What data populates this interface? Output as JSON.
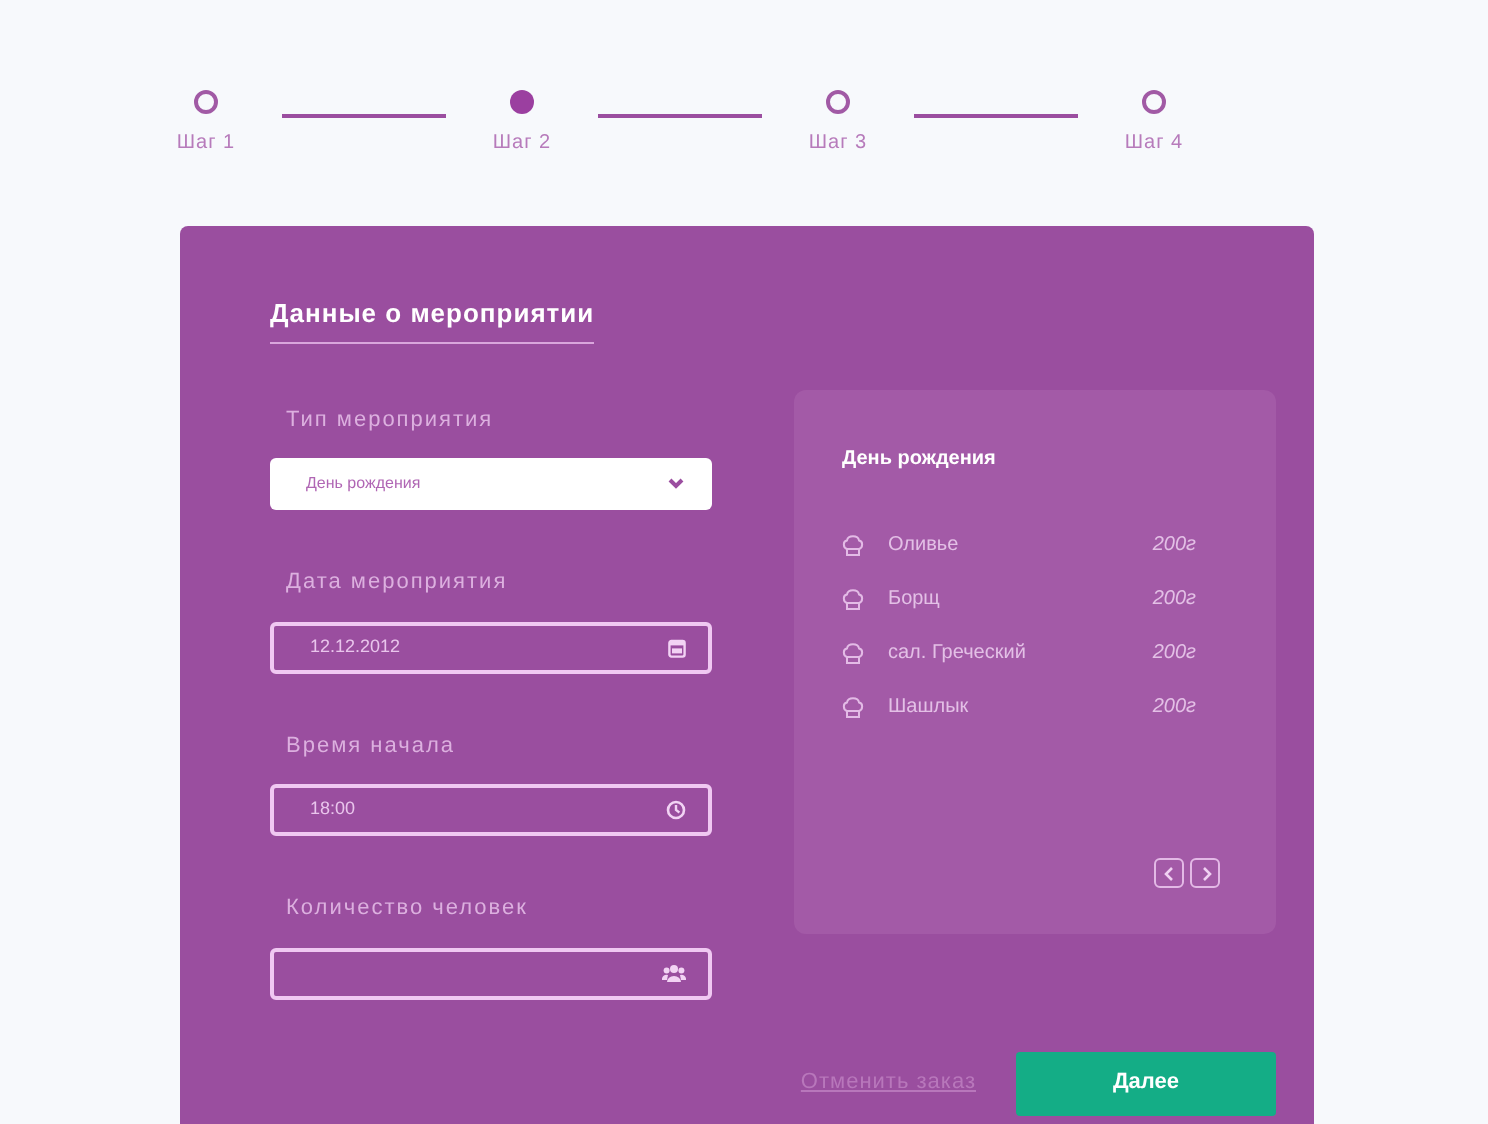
{
  "steps": [
    {
      "label": "Шаг 1",
      "selected": false
    },
    {
      "label": "Шаг 2",
      "selected": true
    },
    {
      "label": "Шаг 3",
      "selected": false
    },
    {
      "label": "Шаг 4",
      "selected": false
    }
  ],
  "form": {
    "title": "Данные о мероприятии",
    "fields": [
      {
        "kind": "select",
        "label": "Тип мероприятия",
        "value": "День рождения"
      },
      {
        "kind": "date",
        "label": "Дата мероприятия",
        "value": "12.12.2012"
      },
      {
        "kind": "time",
        "label": "Время начала",
        "value": "18:00"
      },
      {
        "kind": "people",
        "label": "Количество человек"
      }
    ]
  },
  "menu": {
    "title": "День рождения",
    "items": [
      {
        "name": "Оливье",
        "weight": "200г"
      },
      {
        "name": "Борщ",
        "weight": "200г"
      },
      {
        "name": "сал. Греческий",
        "weight": "200г"
      },
      {
        "name": "Шашлык",
        "weight": "200г"
      }
    ]
  },
  "actions": {
    "cancel": "Отменить заказ",
    "next": "Далее"
  }
}
